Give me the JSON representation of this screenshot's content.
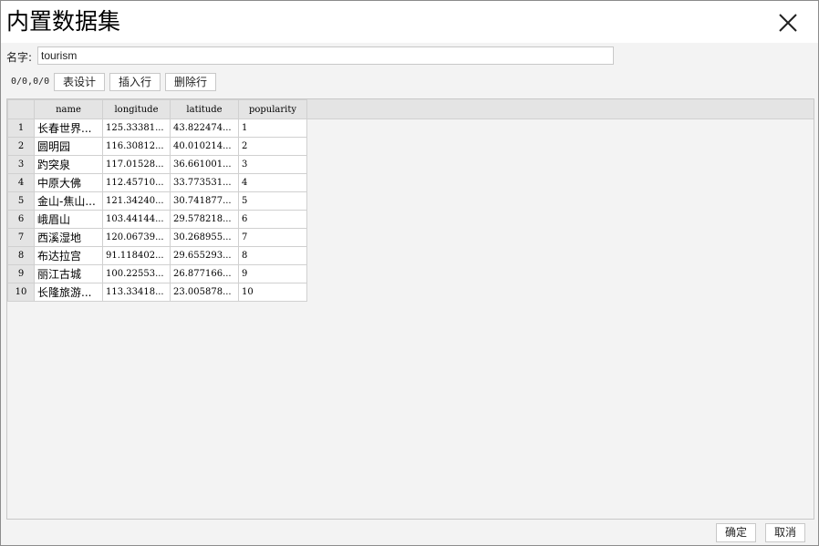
{
  "dialog": {
    "title": "内置数据集",
    "close_icon": "close-icon"
  },
  "name_field": {
    "label": "名字:",
    "value": "tourism"
  },
  "toolbar": {
    "position_readout": "0/0,0/0",
    "design_table_label": "表设计",
    "insert_row_label": "插入行",
    "delete_row_label": "删除行"
  },
  "table": {
    "columns": [
      "name",
      "longitude",
      "latitude",
      "popularity"
    ],
    "rows": [
      {
        "num": "1",
        "name": "长春世界...",
        "longitude": "125.33381...",
        "latitude": "43.822474...",
        "popularity": "1"
      },
      {
        "num": "2",
        "name": "圆明园",
        "longitude": "116.30812...",
        "latitude": "40.010214...",
        "popularity": "2"
      },
      {
        "num": "3",
        "name": "趵突泉",
        "longitude": "117.01528...",
        "latitude": "36.661001...",
        "popularity": "3"
      },
      {
        "num": "4",
        "name": "中原大佛",
        "longitude": "112.45710...",
        "latitude": "33.773531...",
        "popularity": "4"
      },
      {
        "num": "5",
        "name": "金山-焦山...",
        "longitude": "121.34240...",
        "latitude": "30.741877...",
        "popularity": "5"
      },
      {
        "num": "6",
        "name": "峨眉山",
        "longitude": "103.44144...",
        "latitude": "29.578218...",
        "popularity": "6"
      },
      {
        "num": "7",
        "name": "西溪湿地",
        "longitude": "120.06739...",
        "latitude": "30.268955...",
        "popularity": "7"
      },
      {
        "num": "8",
        "name": "布达拉宫",
        "longitude": "91.118402...",
        "latitude": "29.655293...",
        "popularity": "8"
      },
      {
        "num": "9",
        "name": "丽江古城",
        "longitude": "100.22553...",
        "latitude": "26.877166...",
        "popularity": "9"
      },
      {
        "num": "10",
        "name": "长隆旅游...",
        "longitude": "113.33418...",
        "latitude": "23.005878...",
        "popularity": "10"
      }
    ]
  },
  "footer": {
    "ok_label": "确定",
    "cancel_label": "取消"
  }
}
